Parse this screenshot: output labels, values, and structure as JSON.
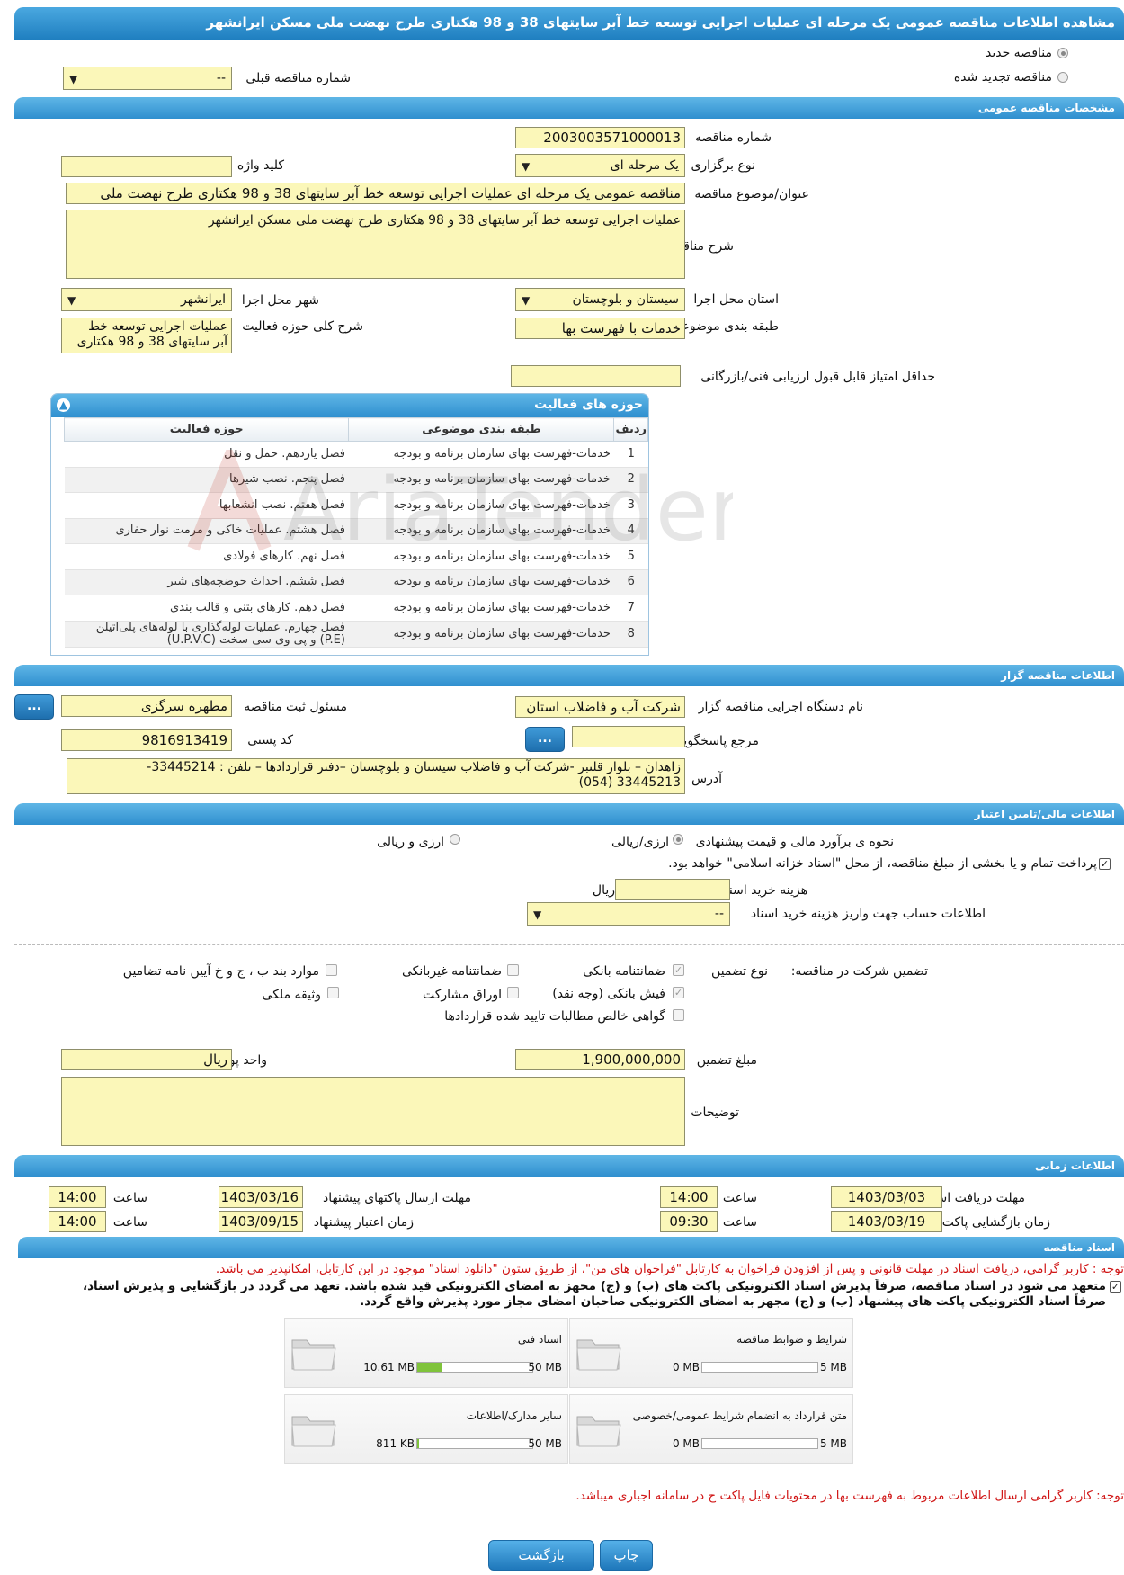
{
  "header": {
    "title": "مشاهده اطلاعات مناقصه عمومی یک مرحله ای عملیات اجرایی توسعه خط آبر سایتهای 38 و 98 هکتاری طرح نهضت ملی مسکن ایرانشهر"
  },
  "top": {
    "radio_new": "مناقصه جدید",
    "radio_renewed": "مناقصه تجدید شده",
    "prev_number_label": "شماره مناقصه قبلی",
    "prev_number_value": "--"
  },
  "sections": {
    "general": "مشخصات مناقصه عمومی",
    "organizer": "اطلاعات مناقصه گزار",
    "financial": "اطلاعات مالی/تامین اعتبار",
    "timing": "اطلاعات زمانی",
    "documents": "اسناد مناقصه"
  },
  "general": {
    "number_label": "شماره مناقصه",
    "number_value": "2003003571000013",
    "type_label": "نوع برگزاری",
    "type_value": "یک مرحله ای",
    "keyword_label": "کلید واژه",
    "keyword_value": "",
    "subject_label": "عنوان/موضوع مناقصه",
    "subject_value": "مناقصه عمومی یک مرحله ای عملیات اجرایی توسعه خط آبر سایتهای 38 و 98 هکتاری طرح نهضت ملی",
    "desc_label": "شرح مناقصه",
    "desc_value": "عملیات اجرایی توسعه خط آبر سایتهای 38 و 98 هکتاری طرح نهضت ملی مسکن ایرانشهر",
    "province_label": "استان محل اجرا",
    "province_value": "سیستان و بلوچستان",
    "city_label": "شهر محل اجرا",
    "city_value": "ایرانشهر",
    "category_label": "طبقه بندی موضوعی",
    "category_value": "خدمات با فهرست بها",
    "scope_label": "شرح کلی حوزه فعالیت",
    "scope_value_1": "عملیات اجرایی توسعه خط",
    "scope_value_2": "آبر سایتهای 38 و 98 هکتاری",
    "min_score_label": "حداقل امتیاز قابل قبول ارزیابی فنی/بازرگانی",
    "min_score_value": ""
  },
  "activities": {
    "title": "حوزه های فعالیت",
    "headers": {
      "row": "ردیف",
      "category": "طبقه بندی موضوعی",
      "field": "حوزه فعالیت"
    },
    "rows": [
      {
        "no": "1",
        "category": "خدمات-فهرست بهای سازمان برنامه و بودجه",
        "field": "فصل یازدهم. حمل و نقل",
        "field2": ""
      },
      {
        "no": "2",
        "category": "خدمات-فهرست بهای سازمان برنامه و بودجه",
        "field": "فصل پنجم. نصب شیرها",
        "field2": ""
      },
      {
        "no": "3",
        "category": "خدمات-فهرست بهای سازمان برنامه و بودجه",
        "field": "فصل هفتم. نصب انشعابها",
        "field2": ""
      },
      {
        "no": "4",
        "category": "خدمات-فهرست بهای سازمان برنامه و بودجه",
        "field": "فصل هشتم. عملیات خاکی و مرمت نوار حفاری",
        "field2": ""
      },
      {
        "no": "5",
        "category": "خدمات-فهرست بهای سازمان برنامه و بودجه",
        "field": "فصل نهم. کارهای فولادی",
        "field2": ""
      },
      {
        "no": "6",
        "category": "خدمات-فهرست بهای سازمان برنامه و بودجه",
        "field": "فصل ششم. احداث حوضچه‌های شیر",
        "field2": ""
      },
      {
        "no": "7",
        "category": "خدمات-فهرست بهای سازمان برنامه و بودجه",
        "field": "فصل دهم. کارهای بتنی و قالب بندی",
        "field2": ""
      },
      {
        "no": "8",
        "category": "خدمات-فهرست بهای سازمان برنامه و بودجه",
        "field": "فصل چهارم. عملیات لوله‌گذاری با لوله‌های پلی‌اتیلن",
        "field2": "(P.E) و پی وی سی سخت (U.P.V.C)"
      }
    ]
  },
  "organizer": {
    "org_label": "نام دستگاه اجرایی مناقصه گزار",
    "org_value": "شرکت آب و فاضلاب استان",
    "resp_label": "مسئول ثبت مناقصه",
    "resp_value": "مطهره سرگزی",
    "ref_label": "مرجع پاسخگویی",
    "ref_value": "",
    "postal_label": "کد پستی",
    "postal_value": "9816913419",
    "address_label": "آدرس",
    "address_1": "زاهدان – بلوار قلنبر -شرکت آب و فاضلاب سیستان و بلوچستان –دفتر قراردادها –  تلفن : 33445214-",
    "address_2": "33445213 (054)",
    "dots": "..."
  },
  "financial": {
    "estimate_label": "نحوه ی برآورد مالی و قیمت پیشنهادی",
    "opt_currency_rial": "ارزی/ریالی",
    "opt_currency_and_rial": "ارزی و ریالی",
    "treasury_note": "پرداخت تمام و یا بخشی از مبلغ مناقصه، از محل \"اسناد خزانه اسلامی\" خواهد بود.",
    "doc_cost_label": "هزینه خرید اسناد",
    "doc_cost_unit": "ریال",
    "doc_cost_value": "",
    "account_label": "اطلاعات حساب جهت واریز هزینه خرید اسناد",
    "account_value": "--"
  },
  "guarantee": {
    "title": "تضمین شرکت در مناقصه:",
    "type_label": "نوع تضمین",
    "bank_guarantee": "ضمانتنامه بانکی",
    "nonbank_guarantee": "ضمانتنامه غیربانکی",
    "clauses": "موارد بند ب ، ج و خ آیین نامه تضامین",
    "bank_receipt": "فیش بانکی (وجه نقد)",
    "participation": "اوراق مشارکت",
    "property": "وثیقه ملکی",
    "net_claims": "گواهی خالص مطالبات تایید شده قراردادها",
    "amount_label": "مبلغ تضمین",
    "amount_value": "1,900,000,000",
    "currency_label": "واحد پول",
    "currency_value": "ریال",
    "notes_label": "توضیحات",
    "notes_value": ""
  },
  "timing": {
    "receive_label": "مهلت دریافت اسناد",
    "receive_date": "1403/03/03",
    "receive_time": "14:00",
    "send_label": "مهلت ارسال پاکتهای پیشنهاد",
    "send_date": "1403/03/16",
    "send_time": "14:00",
    "open_label": "زمان بازگشایی پاکت ها",
    "open_date": "1403/03/19",
    "open_time": "09:30",
    "valid_label": "زمان اعتبار پیشنهاد",
    "valid_date": "1403/09/15",
    "valid_time": "14:00",
    "time_label": "ساعت"
  },
  "documents": {
    "note1": "توجه : کاربر گرامی، دریافت اسناد در مهلت قانونی و پس از افزودن فراخوان به کارتابل \"فراخوان های من\"، از طریق ستون \"دانلود اسناد\" موجود در این کارتابل، امکانپذیر می باشد.",
    "commit_1": "متعهد می شود در اسناد مناقصه، صرفاً پذیرش اسناد الکترونیکی پاکت های (ب) و (ج) مجهز به امضای الکترونیکی قید شده باشد. تعهد می گردد در بازگشایی و پذیرش اسناد،",
    "commit_2": "صرفاً اسناد الکترونیکی پاکت های پیشنهاد (ب) و (ج) مجهز به امضای الکترونیکی صاحبان امضای مجاز مورد پذیرش واقع گردد.",
    "files": [
      {
        "name": "شرایط و ضوابط مناقصه",
        "used": "0 MB",
        "max": "5 MB",
        "progress": 0
      },
      {
        "name": "اسناد فنی",
        "used": "10.61 MB",
        "max": "50 MB",
        "progress": 0.21
      },
      {
        "name": "متن قرارداد به انضمام شرایط عمومی/خصوصی",
        "used": "0 MB",
        "max": "5 MB",
        "progress": 0
      },
      {
        "name": "سایر مدارک/اطلاعات",
        "used": "811 KB",
        "max": "50 MB",
        "progress": 0.016
      }
    ],
    "note2": "توجه: کاربر گرامی ارسال اطلاعات مربوط به فهرست بها در محتویات فایل پاکت ج در سامانه اجباری میباشد."
  },
  "buttons": {
    "back": "بازگشت",
    "print": "چاپ"
  },
  "watermark": "AriaTender.neT"
}
